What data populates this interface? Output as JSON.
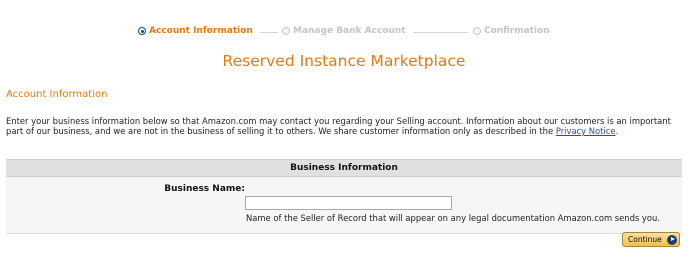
{
  "stepper": {
    "steps": [
      {
        "label": "Account Information",
        "state": "active"
      },
      {
        "label": "Manage Bank Account",
        "state": "inactive"
      },
      {
        "label": "Confirmation",
        "state": "inactive"
      }
    ]
  },
  "page": {
    "title": "Reserved Instance Marketplace",
    "section_heading": "Account Information",
    "intro_text": "Enter your business information below so that Amazon.com may contact you regarding your Selling account. Information about our customers is an important part of our business, and we are not in the business of selling it to others. We share customer information only as described in the ",
    "privacy_link": "Privacy Notice",
    "intro_end": "."
  },
  "business_info": {
    "header": "Business Information",
    "name_label": "Business Name:",
    "name_value": "",
    "name_placeholder": "",
    "name_help": "Name of the Seller of Record that will appear on any legal documentation Amazon.com sends you."
  },
  "actions": {
    "continue_label": "Continue"
  },
  "colors": {
    "accent": "#e47911",
    "link": "#1a52a6",
    "active_dot": "#0d47a1",
    "inactive": "#c4c4c4"
  },
  "icons": {
    "active_step": "radio-selected-icon",
    "inactive_step": "radio-empty-icon",
    "continue_arrow": "arrow-right-icon"
  }
}
